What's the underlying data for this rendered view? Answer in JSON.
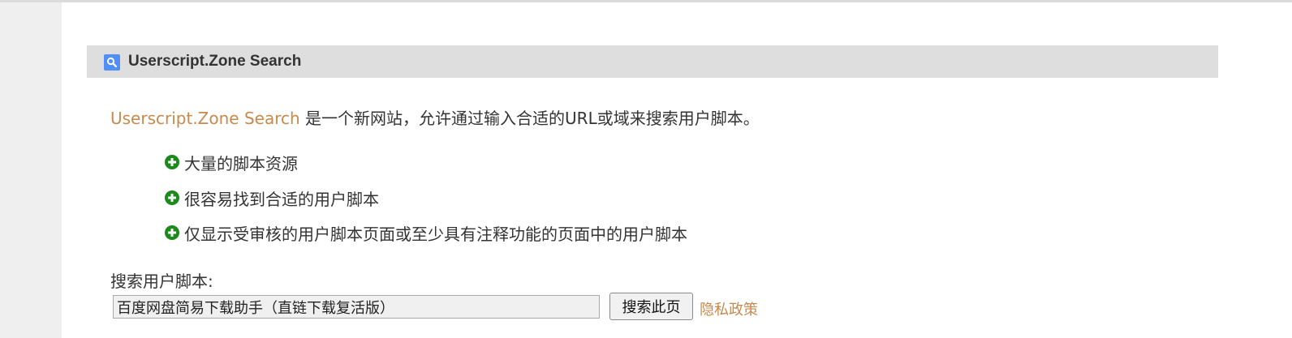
{
  "header": {
    "icon": "search-icon",
    "title": "Userscript.Zone Search",
    "accent_color": "#4f8ff7"
  },
  "intro": {
    "link_text": "Userscript.Zone Search",
    "text": " 是一个新网站，允许通过输入合适的URL或域来搜索用户脚本。",
    "link_color": "#c88a4c"
  },
  "features": [
    {
      "icon": "plus-circle-icon",
      "text": "大量的脚本资源"
    },
    {
      "icon": "plus-circle-icon",
      "text": "很容易找到合适的用户脚本"
    },
    {
      "icon": "plus-circle-icon",
      "text": "仅显示受审核的用户脚本页面或至少具有注释功能的页面中的用户脚本"
    }
  ],
  "feature_icon_color": "#1a8a1a",
  "search": {
    "label": "搜索用户脚本:",
    "value": "百度网盘简易下载助手（直链下载复活版）",
    "button_label": "搜索此页",
    "privacy_link": "隐私政策"
  }
}
